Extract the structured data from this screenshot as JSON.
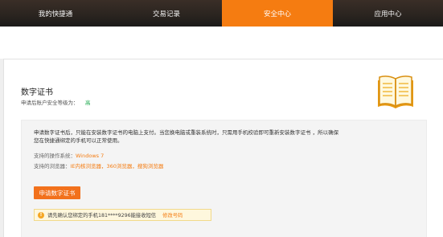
{
  "nav": {
    "tabs": [
      {
        "label": "我的快捷通"
      },
      {
        "label": "交易记录"
      },
      {
        "label": "安全中心",
        "active": true
      },
      {
        "label": "应用中心"
      }
    ]
  },
  "cert": {
    "title": "数字证书",
    "level_label": "申请后账户安全等级为：",
    "level_value": "高",
    "icon": "book-icon"
  },
  "info": {
    "desc_line1": "申请数字证书后，只能在安装数字证书的电脑上支付。当您换电脑或重装系统时，只需用手机校验即可重新安装数字证书 ，所以确保",
    "desc_line2": "您在快捷通绑定的手机可以正常使用。",
    "os_label": "支持的操作系统：",
    "os_value": "Windows 7",
    "browser_label": "支持的浏览器：",
    "browser_value": "IE内核浏览器，360浏览器，搜狗浏览器"
  },
  "apply_button": "申请数字证书",
  "notice": {
    "icon": "warning-icon",
    "text": "请先确认您绑定的手机181****9296能接收短信",
    "link": "修改号码"
  },
  "colors": {
    "accent": "#f57c11",
    "success": "#1aa84b",
    "warning_bg": "#fef7dd"
  }
}
